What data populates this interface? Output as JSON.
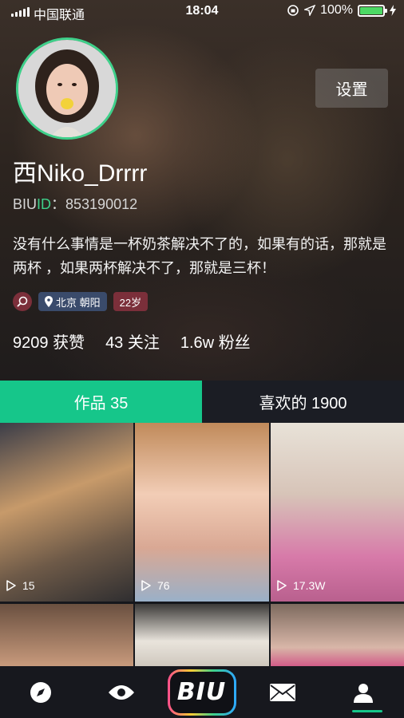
{
  "status_bar": {
    "carrier": "中国联通",
    "time": "18:04",
    "battery_percent": "100%",
    "battery_level": 1.0
  },
  "profile": {
    "settings_label": "设置",
    "username": "西Niko_Drrrr",
    "biuid_prefix": "BIU",
    "biuid_suffix": "ID",
    "biuid_sep": "：",
    "biuid_value": "853190012",
    "bio": "没有什么事情是一杯奶茶解决不了的，如果有的话，那就是两杯 ，如果两杯解决不了，那就是三杯！",
    "location": "北京 朝阳",
    "age": "22岁",
    "stats": [
      {
        "value": "9209",
        "label": "获赞"
      },
      {
        "value": "43",
        "label": "关注"
      },
      {
        "value": "1.6w",
        "label": "粉丝"
      }
    ]
  },
  "tabs": [
    {
      "label": "作品 35",
      "active": true
    },
    {
      "label": "喜欢的 1900",
      "active": false
    }
  ],
  "works": [
    {
      "plays": "15"
    },
    {
      "plays": "76"
    },
    {
      "plays": "17.3W"
    },
    {
      "plays": ""
    },
    {
      "plays": ""
    },
    {
      "plays": ""
    }
  ],
  "bottom_nav": {
    "items": [
      "compass-icon",
      "eye-icon",
      "biu-logo",
      "mail-icon",
      "profile-icon"
    ],
    "logo_text": "BIU",
    "active": "profile-icon"
  },
  "colors": {
    "accent": "#16c68a",
    "avatar_ring": "#3ed08a",
    "tag_red": "#7b2f3a",
    "tag_blue": "#3a4b6b"
  }
}
